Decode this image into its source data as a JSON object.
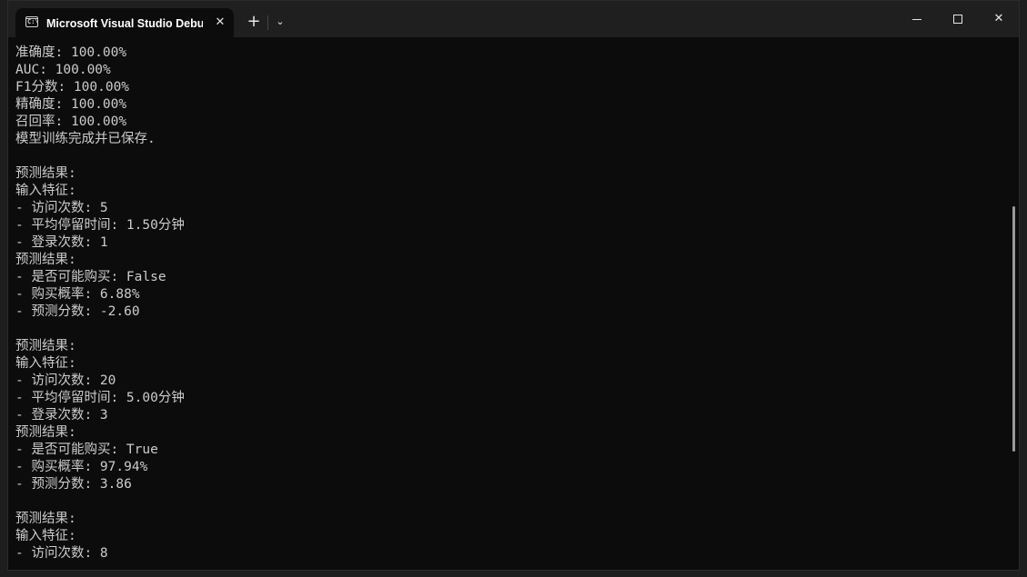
{
  "window": {
    "tab_title": "Microsoft Visual Studio Debug Console",
    "tab_icon_glyph": "C:\\",
    "new_tab_label": "+",
    "dropdown_label": "⌄",
    "close_tab_label": "✕",
    "minimize_label": "",
    "maximize_label": "",
    "close_label": "✕"
  },
  "console": {
    "lines": [
      "准确度: 100.00%",
      "AUC: 100.00%",
      "F1分数: 100.00%",
      "精确度: 100.00%",
      "召回率: 100.00%",
      "模型训练完成并已保存.",
      "",
      "预测结果:",
      "输入特征:",
      "- 访问次数: 5",
      "- 平均停留时间: 1.50分钟",
      "- 登录次数: 1",
      "预测结果:",
      "- 是否可能购买: False",
      "- 购买概率: 6.88%",
      "- 预测分数: -2.60",
      "",
      "预测结果:",
      "输入特征:",
      "- 访问次数: 20",
      "- 平均停留时间: 5.00分钟",
      "- 登录次数: 3",
      "预测结果:",
      "- 是否可能购买: True",
      "- 购买概率: 97.94%",
      "- 预测分数: 3.86",
      "",
      "预测结果:",
      "输入特征:",
      "- 访问次数: 8"
    ]
  }
}
